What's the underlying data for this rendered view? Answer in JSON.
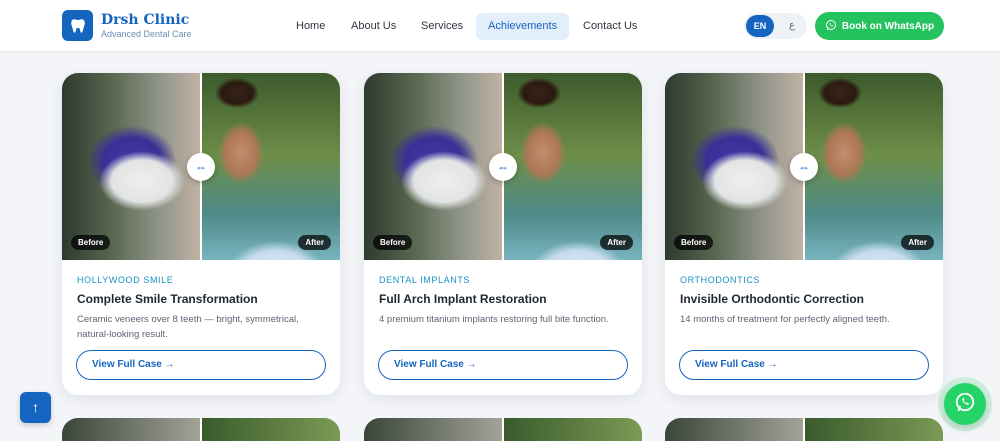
{
  "brand": {
    "name": "Drsh Clinic",
    "tagline": "Advanced Dental Care",
    "icon": "tooth-icon"
  },
  "nav": {
    "items": [
      {
        "label": "Home",
        "active": false
      },
      {
        "label": "About Us",
        "active": false
      },
      {
        "label": "Services",
        "active": false
      },
      {
        "label": "Achievements",
        "active": true
      },
      {
        "label": "Contact Us",
        "active": false
      }
    ],
    "lang_active": "EN",
    "lang_other": "ع",
    "cta_label": "Book on WhatsApp"
  },
  "cards": [
    {
      "category": "HOLLYWOOD SMILE",
      "title": "Complete Smile Transformation",
      "description": "Ceramic veneers over 8 teeth — bright, symmetrical, natural-looking result.",
      "before_label": "Before",
      "after_label": "After",
      "button": "View Full Case →"
    },
    {
      "category": "DENTAL IMPLANTS",
      "title": "Full Arch Implant Restoration",
      "description": "4 premium titanium implants restoring full bite function.",
      "before_label": "Before",
      "after_label": "After",
      "button": "View Full Case →"
    },
    {
      "category": "ORTHODONTICS",
      "title": "Invisible Orthodontic Correction",
      "description": "14 months of treatment for perfectly aligned teeth.",
      "before_label": "Before",
      "after_label": "After",
      "button": "View Full Case →"
    }
  ],
  "slider_handle_glyph": "⇔",
  "scroll_top_glyph": "↑",
  "colors": {
    "primary": "#1565c0",
    "whatsapp": "#25d366",
    "accent_cyan": "#1593c4"
  }
}
